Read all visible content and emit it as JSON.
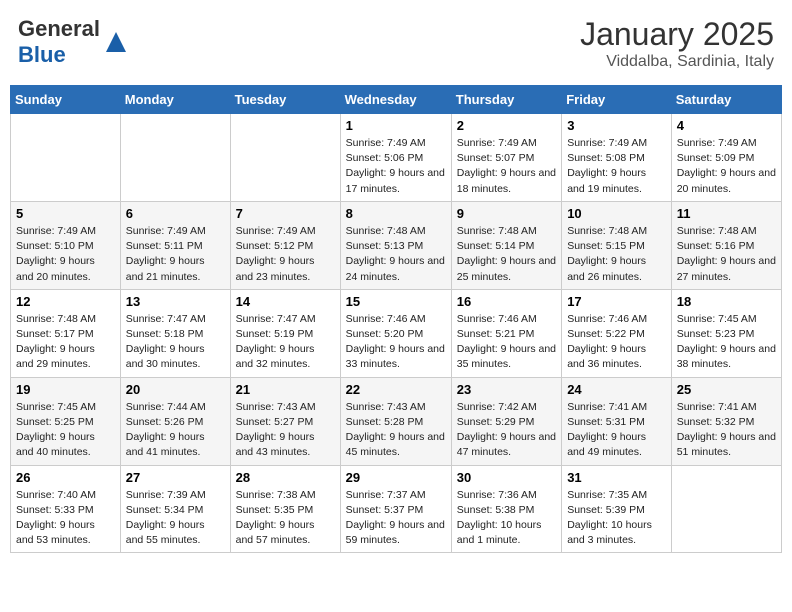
{
  "logo": {
    "general": "General",
    "blue": "Blue"
  },
  "header": {
    "month": "January 2025",
    "location": "Viddalba, Sardinia, Italy"
  },
  "days_of_week": [
    "Sunday",
    "Monday",
    "Tuesday",
    "Wednesday",
    "Thursday",
    "Friday",
    "Saturday"
  ],
  "weeks": [
    [
      {
        "day": "",
        "info": ""
      },
      {
        "day": "",
        "info": ""
      },
      {
        "day": "",
        "info": ""
      },
      {
        "day": "1",
        "info": "Sunrise: 7:49 AM\nSunset: 5:06 PM\nDaylight: 9 hours and 17 minutes."
      },
      {
        "day": "2",
        "info": "Sunrise: 7:49 AM\nSunset: 5:07 PM\nDaylight: 9 hours and 18 minutes."
      },
      {
        "day": "3",
        "info": "Sunrise: 7:49 AM\nSunset: 5:08 PM\nDaylight: 9 hours and 19 minutes."
      },
      {
        "day": "4",
        "info": "Sunrise: 7:49 AM\nSunset: 5:09 PM\nDaylight: 9 hours and 20 minutes."
      }
    ],
    [
      {
        "day": "5",
        "info": "Sunrise: 7:49 AM\nSunset: 5:10 PM\nDaylight: 9 hours and 20 minutes."
      },
      {
        "day": "6",
        "info": "Sunrise: 7:49 AM\nSunset: 5:11 PM\nDaylight: 9 hours and 21 minutes."
      },
      {
        "day": "7",
        "info": "Sunrise: 7:49 AM\nSunset: 5:12 PM\nDaylight: 9 hours and 23 minutes."
      },
      {
        "day": "8",
        "info": "Sunrise: 7:48 AM\nSunset: 5:13 PM\nDaylight: 9 hours and 24 minutes."
      },
      {
        "day": "9",
        "info": "Sunrise: 7:48 AM\nSunset: 5:14 PM\nDaylight: 9 hours and 25 minutes."
      },
      {
        "day": "10",
        "info": "Sunrise: 7:48 AM\nSunset: 5:15 PM\nDaylight: 9 hours and 26 minutes."
      },
      {
        "day": "11",
        "info": "Sunrise: 7:48 AM\nSunset: 5:16 PM\nDaylight: 9 hours and 27 minutes."
      }
    ],
    [
      {
        "day": "12",
        "info": "Sunrise: 7:48 AM\nSunset: 5:17 PM\nDaylight: 9 hours and 29 minutes."
      },
      {
        "day": "13",
        "info": "Sunrise: 7:47 AM\nSunset: 5:18 PM\nDaylight: 9 hours and 30 minutes."
      },
      {
        "day": "14",
        "info": "Sunrise: 7:47 AM\nSunset: 5:19 PM\nDaylight: 9 hours and 32 minutes."
      },
      {
        "day": "15",
        "info": "Sunrise: 7:46 AM\nSunset: 5:20 PM\nDaylight: 9 hours and 33 minutes."
      },
      {
        "day": "16",
        "info": "Sunrise: 7:46 AM\nSunset: 5:21 PM\nDaylight: 9 hours and 35 minutes."
      },
      {
        "day": "17",
        "info": "Sunrise: 7:46 AM\nSunset: 5:22 PM\nDaylight: 9 hours and 36 minutes."
      },
      {
        "day": "18",
        "info": "Sunrise: 7:45 AM\nSunset: 5:23 PM\nDaylight: 9 hours and 38 minutes."
      }
    ],
    [
      {
        "day": "19",
        "info": "Sunrise: 7:45 AM\nSunset: 5:25 PM\nDaylight: 9 hours and 40 minutes."
      },
      {
        "day": "20",
        "info": "Sunrise: 7:44 AM\nSunset: 5:26 PM\nDaylight: 9 hours and 41 minutes."
      },
      {
        "day": "21",
        "info": "Sunrise: 7:43 AM\nSunset: 5:27 PM\nDaylight: 9 hours and 43 minutes."
      },
      {
        "day": "22",
        "info": "Sunrise: 7:43 AM\nSunset: 5:28 PM\nDaylight: 9 hours and 45 minutes."
      },
      {
        "day": "23",
        "info": "Sunrise: 7:42 AM\nSunset: 5:29 PM\nDaylight: 9 hours and 47 minutes."
      },
      {
        "day": "24",
        "info": "Sunrise: 7:41 AM\nSunset: 5:31 PM\nDaylight: 9 hours and 49 minutes."
      },
      {
        "day": "25",
        "info": "Sunrise: 7:41 AM\nSunset: 5:32 PM\nDaylight: 9 hours and 51 minutes."
      }
    ],
    [
      {
        "day": "26",
        "info": "Sunrise: 7:40 AM\nSunset: 5:33 PM\nDaylight: 9 hours and 53 minutes."
      },
      {
        "day": "27",
        "info": "Sunrise: 7:39 AM\nSunset: 5:34 PM\nDaylight: 9 hours and 55 minutes."
      },
      {
        "day": "28",
        "info": "Sunrise: 7:38 AM\nSunset: 5:35 PM\nDaylight: 9 hours and 57 minutes."
      },
      {
        "day": "29",
        "info": "Sunrise: 7:37 AM\nSunset: 5:37 PM\nDaylight: 9 hours and 59 minutes."
      },
      {
        "day": "30",
        "info": "Sunrise: 7:36 AM\nSunset: 5:38 PM\nDaylight: 10 hours and 1 minute."
      },
      {
        "day": "31",
        "info": "Sunrise: 7:35 AM\nSunset: 5:39 PM\nDaylight: 10 hours and 3 minutes."
      },
      {
        "day": "",
        "info": ""
      }
    ]
  ]
}
